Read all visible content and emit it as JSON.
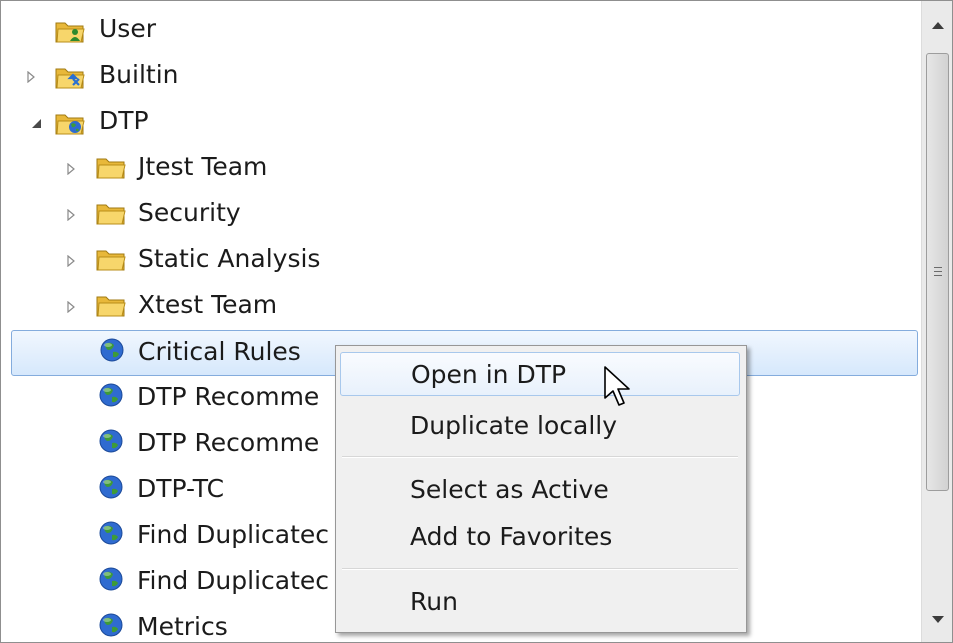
{
  "colors": {
    "selection_border": "#84acdd",
    "menu_background": "#f0f0f0",
    "menu_hover_border": "#a8c8ec",
    "folder_yellow": "#f2c94c",
    "globe_blue": "#2f6bd0",
    "globe_green": "#3e9b37"
  },
  "tree": {
    "items": [
      {
        "label": "User",
        "icon": "user-folder-icon",
        "twisty": "none"
      },
      {
        "label": "Builtin",
        "icon": "builtin-folder-icon",
        "twisty": "collapsed"
      },
      {
        "label": "DTP",
        "icon": "dtp-folder-icon",
        "twisty": "expanded"
      },
      {
        "label": "Jtest Team",
        "icon": "folder-icon",
        "twisty": "collapsed"
      },
      {
        "label": "Security",
        "icon": "folder-icon",
        "twisty": "collapsed"
      },
      {
        "label": "Static Analysis",
        "icon": "folder-icon",
        "twisty": "collapsed"
      },
      {
        "label": "Xtest Team",
        "icon": "folder-icon",
        "twisty": "collapsed"
      },
      {
        "label": "Critical Rules",
        "icon": "globe-icon",
        "twisty": "none",
        "selected": true
      },
      {
        "label": "DTP Recomme",
        "icon": "globe-icon",
        "twisty": "none"
      },
      {
        "label": "DTP Recomme",
        "icon": "globe-icon",
        "twisty": "none"
      },
      {
        "label": "DTP-TC",
        "icon": "globe-icon",
        "twisty": "none"
      },
      {
        "label": "Find Duplicatec",
        "icon": "globe-icon",
        "twisty": "none"
      },
      {
        "label": "Find Duplicatec",
        "icon": "globe-icon",
        "twisty": "none"
      },
      {
        "label": "Metrics",
        "icon": "globe-icon",
        "twisty": "none"
      }
    ]
  },
  "context_menu": {
    "items": [
      {
        "label": "Open in DTP",
        "hovered": true
      },
      {
        "label": "Duplicate locally"
      },
      {
        "label": "Select as Active"
      },
      {
        "label": "Add to Favorites"
      },
      {
        "label": "Run"
      }
    ]
  },
  "scrollbar": {
    "up_icon": "scroll-up-arrow-icon",
    "down_icon": "scroll-down-arrow-icon"
  }
}
